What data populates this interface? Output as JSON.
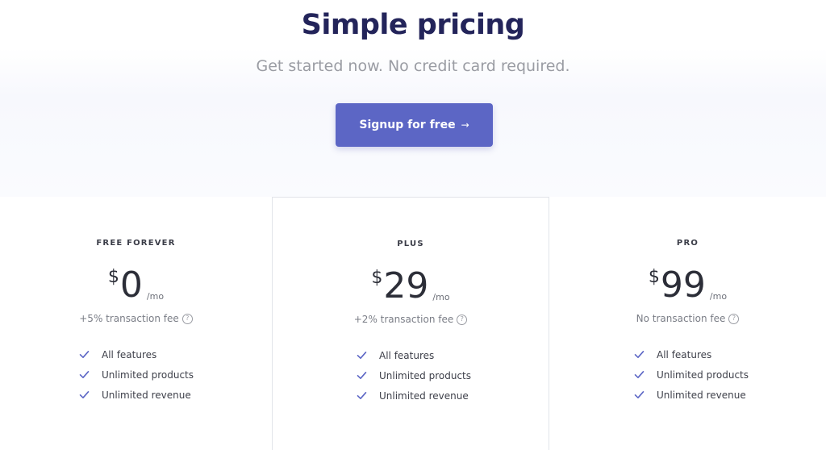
{
  "header": {
    "title": "Simple pricing",
    "subtitle": "Get started now. No credit card required.",
    "cta_label": "Signup for free",
    "cta_arrow": "→"
  },
  "plans": [
    {
      "name": "FREE FOREVER",
      "currency": "$",
      "amount": "0",
      "period": "/mo",
      "fee": "+5% transaction fee",
      "features": [
        "All features",
        "Unlimited products",
        "Unlimited revenue"
      ]
    },
    {
      "name": "PLUS",
      "currency": "$",
      "amount": "29",
      "period": "/mo",
      "fee": "+2% transaction fee",
      "features": [
        "All features",
        "Unlimited products",
        "Unlimited revenue"
      ]
    },
    {
      "name": "PRO",
      "currency": "$",
      "amount": "99",
      "period": "/mo",
      "fee": "No transaction fee",
      "features": [
        "All features",
        "Unlimited products",
        "Unlimited revenue"
      ]
    }
  ],
  "icons": {
    "help": "?",
    "check_icon_name": "check-icon",
    "help_icon_name": "question-circle-icon"
  },
  "colors": {
    "title": "#23245a",
    "accent": "#5c66c5",
    "check": "#5c66c5",
    "muted_text": "#9a9ca3"
  }
}
